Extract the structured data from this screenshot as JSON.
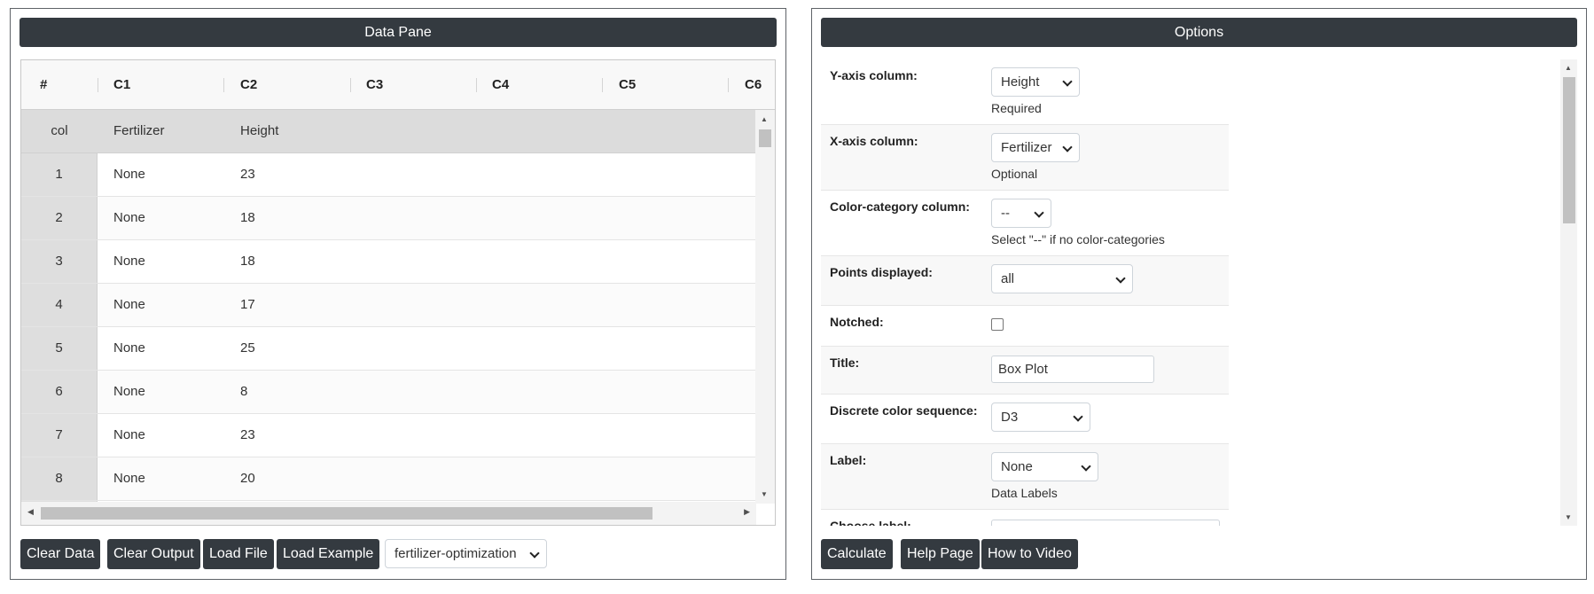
{
  "data_pane": {
    "title": "Data Pane",
    "columns": [
      "#",
      "C1",
      "C2",
      "C3",
      "C4",
      "C5",
      "C6"
    ],
    "header_row": {
      "label": "col",
      "c1": "Fertilizer",
      "c2": "Height"
    },
    "rows": [
      {
        "num": "1",
        "c1": "None",
        "c2": "23"
      },
      {
        "num": "2",
        "c1": "None",
        "c2": "18"
      },
      {
        "num": "3",
        "c1": "None",
        "c2": "18"
      },
      {
        "num": "4",
        "c1": "None",
        "c2": "17"
      },
      {
        "num": "5",
        "c1": "None",
        "c2": "25"
      },
      {
        "num": "6",
        "c1": "None",
        "c2": "8"
      },
      {
        "num": "7",
        "c1": "None",
        "c2": "23"
      },
      {
        "num": "8",
        "c1": "None",
        "c2": "20"
      }
    ],
    "buttons": {
      "clear_data": "Clear Data",
      "clear_output": "Clear Output",
      "load_file": "Load File",
      "load_example": "Load Example"
    },
    "example_select": "fertilizer-optimization"
  },
  "options": {
    "title": "Options",
    "y_axis": {
      "label": "Y-axis column:",
      "value": "Height",
      "help": "Required"
    },
    "x_axis": {
      "label": "X-axis column:",
      "value": "Fertilizer",
      "help": "Optional"
    },
    "color_category": {
      "label": "Color-category column:",
      "value": "--",
      "help": "Select \"--\" if no color-categories"
    },
    "points": {
      "label": "Points displayed:",
      "value": "all"
    },
    "notched": {
      "label": "Notched:"
    },
    "title_field": {
      "label": "Title:",
      "value": "Box Plot"
    },
    "color_sequence": {
      "label": "Discrete color sequence:",
      "value": "D3"
    },
    "label_field": {
      "label": "Label:",
      "value": "None",
      "help": "Data Labels"
    },
    "choose_label": {
      "label": "Choose label:"
    },
    "buttons": {
      "calculate": "Calculate",
      "help_page": "Help Page",
      "how_to_video": "How to Video"
    }
  }
}
